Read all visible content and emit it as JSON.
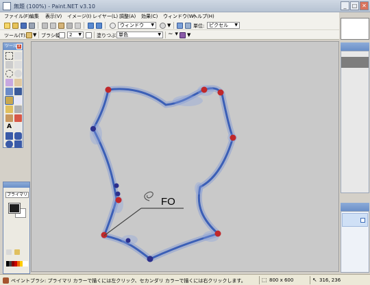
{
  "window": {
    "title": "無題 (100%) - Paint.NET v3.10"
  },
  "menu": {
    "items": [
      "ファイル(F)",
      "編集",
      "表示(V)",
      "イメージ(I)",
      "レイヤー(L)",
      "調整(A)",
      "効果(C)",
      "ウィンドウ(W)",
      "ヘルプ(H)"
    ]
  },
  "toolbar": {
    "window_label": "ウィンドウ",
    "units_label": "単位:",
    "units_value": "ピクセル"
  },
  "tool_options": {
    "tool_label": "ツール(T):",
    "brush_width_label": "ブラシ幅",
    "brush_width_value": "2",
    "fill_label": "塗りつぶし:",
    "fill_value": "単色"
  },
  "panels": {
    "tools_title": "ツール",
    "colors_combo": "プライマリ カラー"
  },
  "canvas": {
    "annotation_text": "FO",
    "stroke_color": "#3b5fb6",
    "node_color": "#c0282a",
    "node_alt_color": "#2c2f8c"
  },
  "statusbar": {
    "hint": "ペイントブラシ: プライマリ カラーで描くには左クリック、セカンダリ カラーで描くには右クリックします。",
    "image_size": "800 x 600",
    "cursor_position": "316, 236"
  }
}
